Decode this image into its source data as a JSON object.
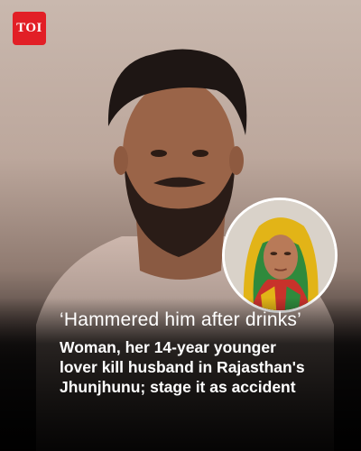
{
  "brand": {
    "logo_text": "TOI",
    "logo_color": "#e21f26"
  },
  "quote": "‘Hammered him after drinks’",
  "headline_lines": [
    "Woman, her 14-year younger",
    "lover kill husband in Rajasthan's",
    "Jhunjhunu; stage it as accident"
  ],
  "images": {
    "main_photo": "man-portrait",
    "inset_photo": "woman-portrait"
  }
}
